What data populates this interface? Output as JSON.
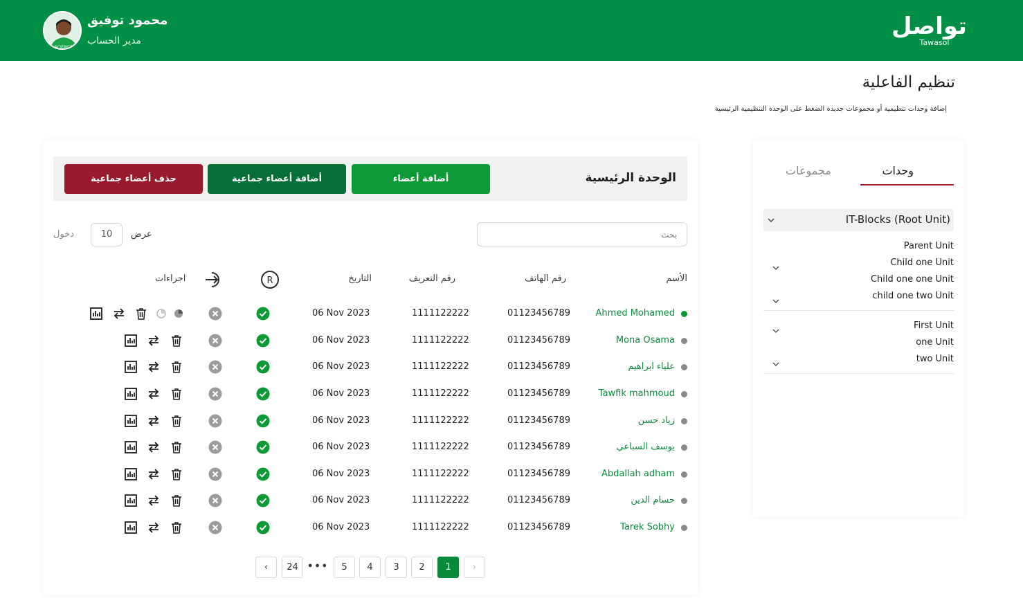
{
  "header": {
    "logo_text": "تواصل",
    "logo_sub": "Tawasol",
    "user_name": "محمود توفيق",
    "user_role": "مدير الحساب",
    "brand_color": "#008f44"
  },
  "page": {
    "title": "تنظيم الفاعلية",
    "subtitle": "إضافة وحدات تنظيمية أو مجموعات جديدة الضغط على الوحدة التنظيمية الرئيسية"
  },
  "unit_panel": {
    "title": "الوحدة الرئيسية",
    "add_members": "أضافة أعضاء",
    "bulk_add": "أضافة أعضاء جماعية",
    "bulk_delete": "حذف أعضاء جماعية"
  },
  "controls": {
    "search_placeholder": "بحث",
    "show_label": "عرض",
    "page_size": "10",
    "entries_label": "دخول"
  },
  "table": {
    "headers": {
      "name": "الأسم",
      "phone": "رقم الهاتف",
      "id": "رقم التعريف",
      "date": "التاريخ",
      "actions": "اجراءات"
    },
    "rows": [
      {
        "name": "Ahmed Mohamed",
        "phone": "01123456789",
        "id": "1111122222",
        "date": "06 Nov 2023",
        "active": true
      },
      {
        "name": "Mona Osama",
        "phone": "01123456789",
        "id": "1111122222",
        "date": "06 Nov 2023",
        "active": false
      },
      {
        "name": "علياء ابراهيم",
        "phone": "01123456789",
        "id": "1111122222",
        "date": "06 Nov 2023",
        "active": false
      },
      {
        "name": "Tawfik mahmoud",
        "phone": "01123456789",
        "id": "1111122222",
        "date": "06 Nov 2023",
        "active": false
      },
      {
        "name": "زياد حسن",
        "phone": "01123456789",
        "id": "1111122222",
        "date": "06 Nov 2023",
        "active": false
      },
      {
        "name": "يوسف السباعي",
        "phone": "01123456789",
        "id": "1111122222",
        "date": "06 Nov 2023",
        "active": false
      },
      {
        "name": "Abdallah adham",
        "phone": "01123456789",
        "id": "1111122222",
        "date": "06 Nov 2023",
        "active": false
      },
      {
        "name": "حسام الدين",
        "phone": "01123456789",
        "id": "1111122222",
        "date": "06 Nov 2023",
        "active": false
      },
      {
        "name": "Tarek Sobhy",
        "phone": "01123456789",
        "id": "1111122222",
        "date": "06 Nov 2023",
        "active": false
      }
    ]
  },
  "pagination": {
    "pages": [
      "1",
      "2",
      "3",
      "4",
      "5"
    ],
    "ellipsis": "•••",
    "last": "24",
    "current": "1"
  },
  "sidebar": {
    "tab_units": "وحدات",
    "tab_groups": "مجموعات",
    "root": "IT-Blocks (Root Unit)",
    "group1": [
      {
        "label": "Parent Unit",
        "chevron": false
      },
      {
        "label": "Child one Unit",
        "chevron": true
      },
      {
        "label": "Child one one Unit",
        "chevron": false
      },
      {
        "label": "child one two Unit",
        "chevron": true
      }
    ],
    "group2": [
      {
        "label": "First Unit",
        "chevron": true
      },
      {
        "label": "one Unit",
        "chevron": false
      },
      {
        "label": "two Unit",
        "chevron": true
      }
    ]
  },
  "colors": {
    "accent": "#0d9a36",
    "danger": "#971b2d",
    "dark_green": "#066f37"
  }
}
